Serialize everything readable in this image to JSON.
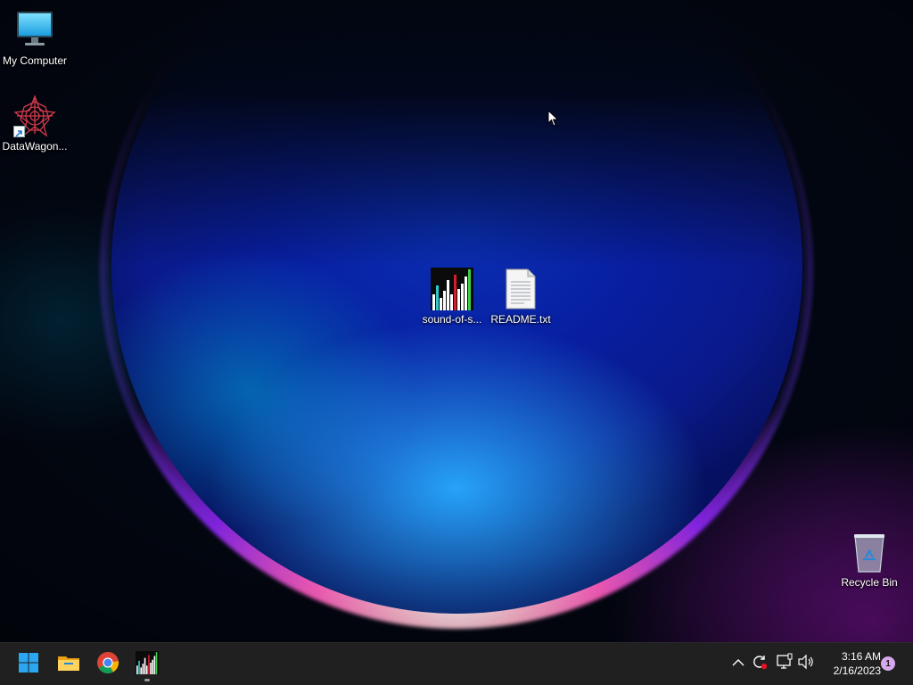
{
  "desktop": {
    "icons": [
      {
        "name": "my-computer",
        "label": "My Computer",
        "icon": "monitor-icon"
      },
      {
        "name": "datawagon",
        "label": "DataWagon...",
        "icon": "star-mandala-icon",
        "shortcut": true
      },
      {
        "name": "sound-of-sorting",
        "label": "sound-of-s...",
        "icon": "bar-visualizer-icon"
      },
      {
        "name": "readme",
        "label": "README.txt",
        "icon": "text-file-icon"
      },
      {
        "name": "recycle-bin",
        "label": "Recycle Bin",
        "icon": "recycle-bin-icon"
      }
    ]
  },
  "taskbar": {
    "apps": [
      {
        "name": "start",
        "icon": "windows-start-icon"
      },
      {
        "name": "file-explorer",
        "icon": "folder-icon"
      },
      {
        "name": "chrome",
        "icon": "chrome-icon"
      },
      {
        "name": "sound-of-sorting",
        "icon": "bar-visualizer-icon",
        "running": true
      }
    ],
    "tray": {
      "icons": [
        "chevron-up-icon",
        "sync-alert-icon",
        "network-icon",
        "volume-icon"
      ],
      "time": "3:16 AM",
      "date": "2/16/2023",
      "notification_count": "1"
    }
  },
  "colors": {
    "taskbar_bg": "#202020",
    "badge": "#d7a8ec",
    "desktop_blue": "#0a2fb4",
    "desktop_magenta": "#8c14aa"
  }
}
